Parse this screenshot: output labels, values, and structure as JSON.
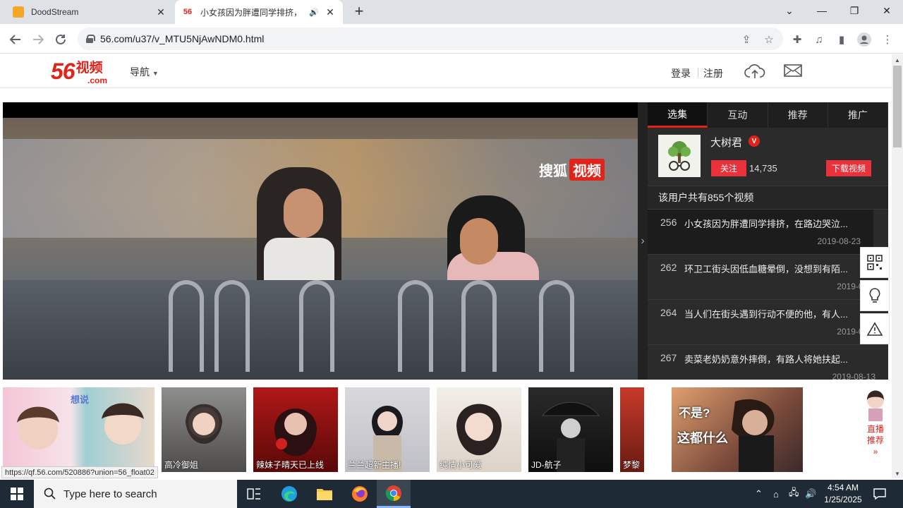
{
  "browser": {
    "tabs": [
      {
        "title": "DoodStream"
      },
      {
        "title": "小女孩因为胖遭同学排挤，"
      }
    ],
    "tab2_favicon": "56",
    "url": "56.com/u37/v_MTU5NjAwNDM0.html"
  },
  "site": {
    "logo_num": "56",
    "logo_text": "视频",
    "logo_com": ".com",
    "nav_menu": "导航",
    "login": "登录",
    "register": "注册"
  },
  "player": {
    "watermark_left": "搜狐",
    "watermark_right": "视频"
  },
  "panel": {
    "tabs": [
      "选集",
      "互动",
      "推荐",
      "推广"
    ],
    "uploader_name": "大树君",
    "follow_label": "关注",
    "follow_count": "14,735",
    "download_label": "下载视频",
    "count_text": "该用户共有855个视频",
    "videos": [
      {
        "num": "256",
        "title": "小女孩因为胖遭同学排挤，在路边哭泣...",
        "date": "2019-08-23"
      },
      {
        "num": "262",
        "title": "环卫工街头因低血糖晕倒，没想到有陌...",
        "date": "2019-08-2"
      },
      {
        "num": "264",
        "title": "当人们在街头遇到行动不便的他，有人...",
        "date": "2019-08-1"
      },
      {
        "num": "267",
        "title": "卖菜老奶奶意外摔倒，有路人将她扶起...",
        "date": "2019-08-13"
      }
    ]
  },
  "ads": {
    "cards": [
      {
        "label": "高冷御姐"
      },
      {
        "label": "辣妹子晴天已上线"
      },
      {
        "label": "兰兰超新主播!"
      },
      {
        "label": "纯情小可爱"
      },
      {
        "label": "JD-航子"
      },
      {
        "label": "梦黎"
      }
    ],
    "promo_line1": "不是?",
    "promo_line2": "这都什么",
    "live_label1": "直播",
    "live_label2": "推荐"
  },
  "status_url": "https://qf.56.com/520886?union=56_float02",
  "taskbar": {
    "search_placeholder": "Type here to search",
    "time": "4:54 AM",
    "date": "1/25/2025"
  },
  "colors": {
    "brand_red": "#e2231a",
    "panel_bg": "#2b2b2b",
    "taskbar_bg": "#1e2a35"
  }
}
